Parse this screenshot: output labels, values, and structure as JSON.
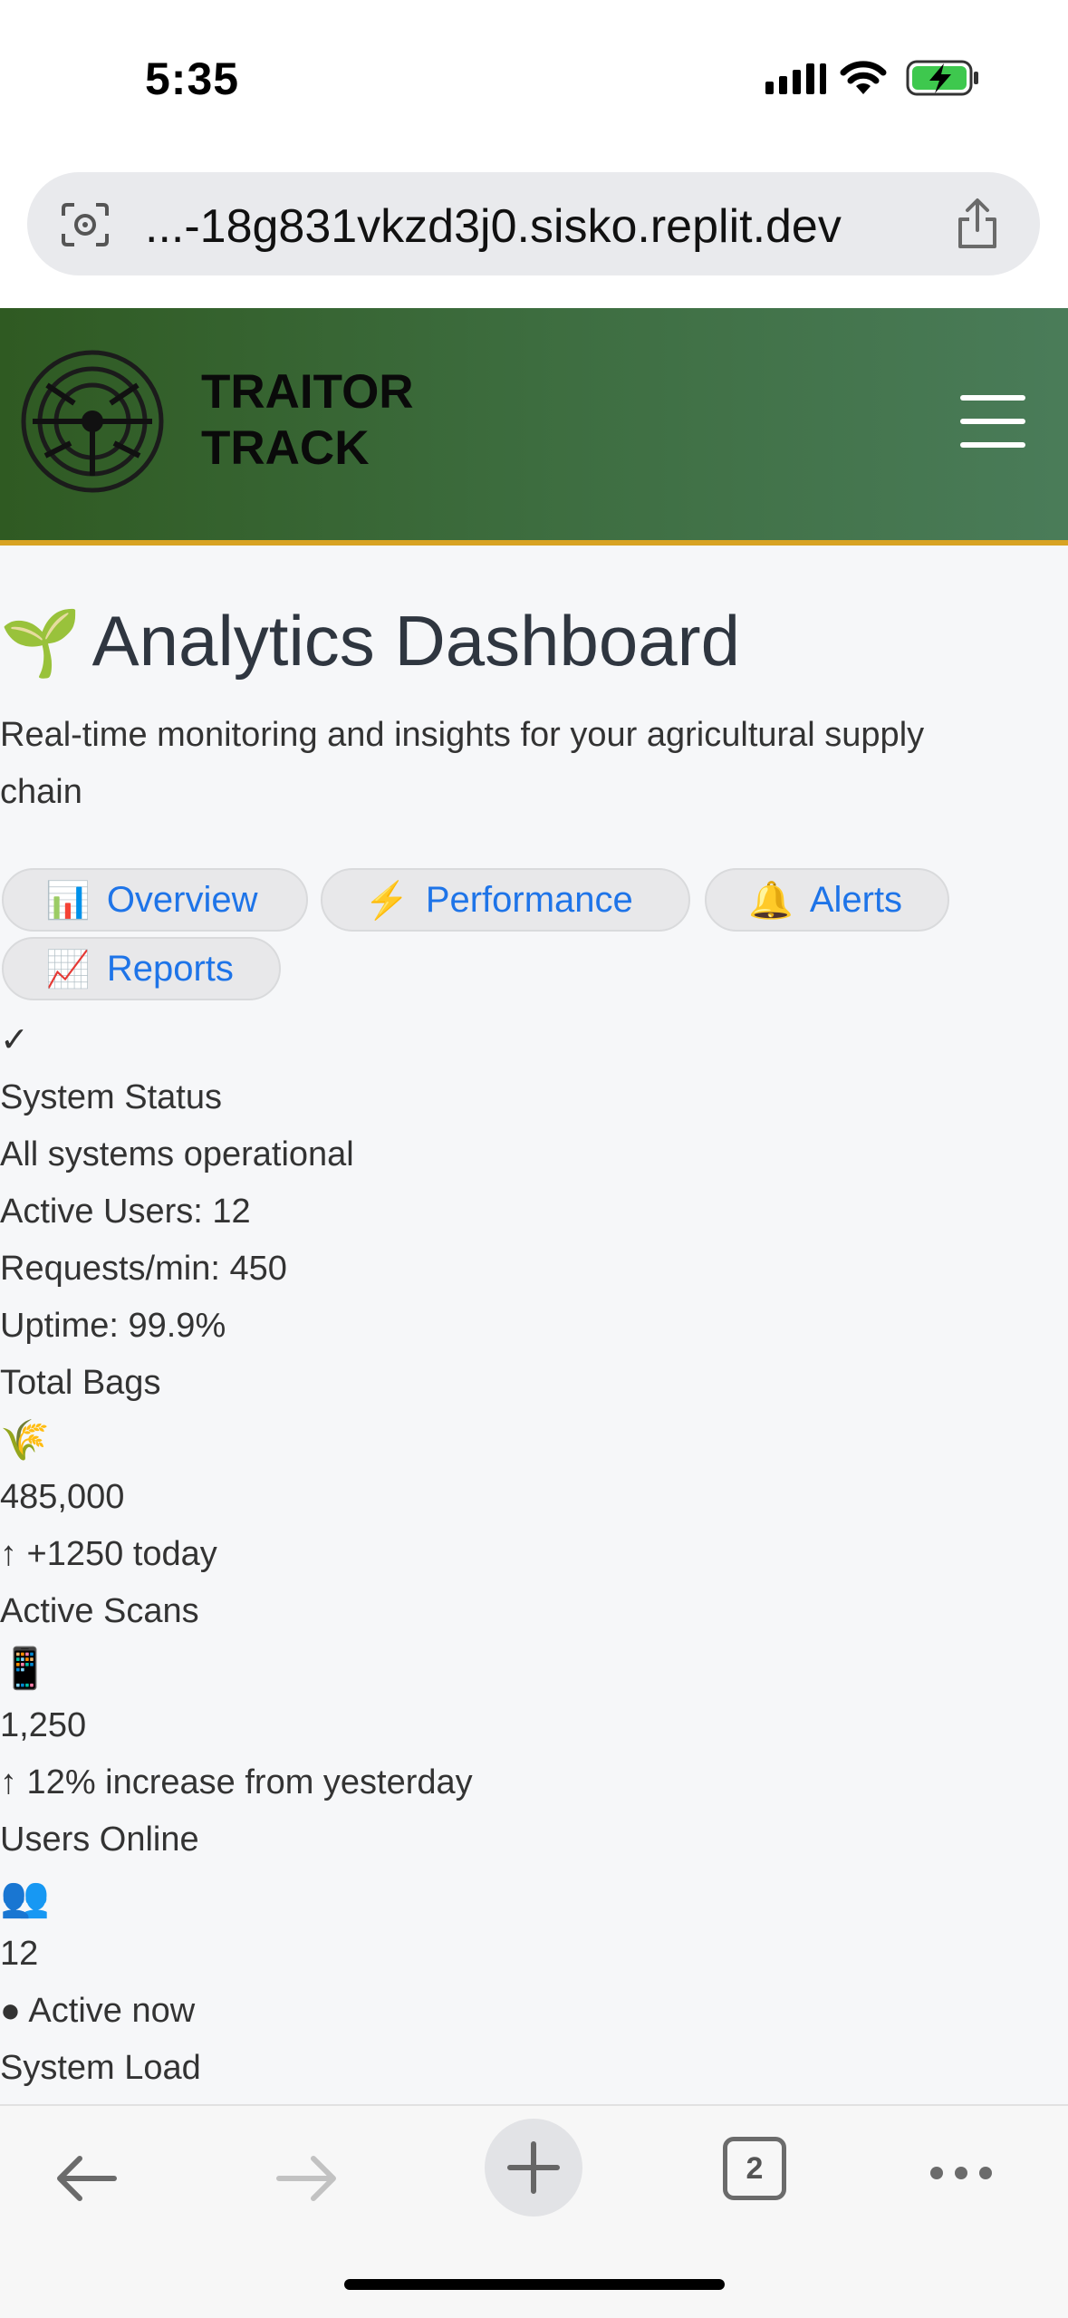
{
  "status_bar": {
    "time": "5:35"
  },
  "browser": {
    "url": "...-18g831vkzd3j0.sisko.replit.dev",
    "tab_count": "2"
  },
  "header": {
    "brand_line1": "TRAITOR",
    "brand_line2": "TRACK"
  },
  "page": {
    "title_emoji": "🌱",
    "title": "Analytics Dashboard",
    "subtitle": "Real-time monitoring and insights for your agricultural supply chain",
    "tabs": [
      {
        "icon": "📊",
        "label": "Overview"
      },
      {
        "icon": "⚡",
        "label": "Performance"
      },
      {
        "icon": "🔔",
        "label": "Alerts"
      },
      {
        "icon": "📈",
        "label": "Reports"
      }
    ],
    "system_status": {
      "check": "✓",
      "label": "System Status",
      "message": "All systems operational",
      "active_users": "Active Users: 12",
      "requests": "Requests/min: 450",
      "uptime": "Uptime: 99.9%"
    },
    "cards": {
      "total_bags": {
        "label": "Total Bags",
        "icon": "🌾",
        "value": "485,000",
        "change": "↑ +1250 today"
      },
      "active_scans": {
        "label": "Active Scans",
        "icon": "📱",
        "value": "1,250",
        "change": "↑ 12% increase from yesterday"
      },
      "users_online": {
        "label": "Users Online",
        "icon": "👥",
        "value": "12",
        "change": "● Active now"
      },
      "system_load": {
        "label": "System Load"
      }
    }
  }
}
